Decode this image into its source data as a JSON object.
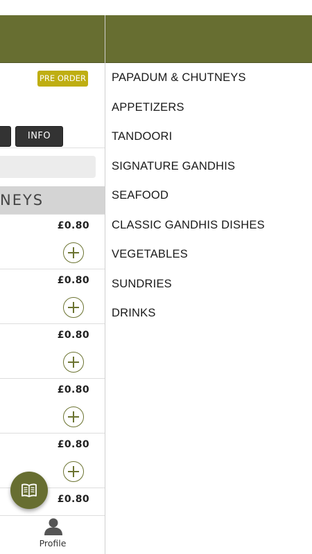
{
  "left_panel": {
    "preorder_label": "PRE ORDER",
    "info_button_label": "INFO",
    "category_banner": "NEYS",
    "items": [
      {
        "price": "£0.80"
      },
      {
        "price": "£0.80"
      },
      {
        "price": "£0.80"
      },
      {
        "price": "£0.80"
      },
      {
        "price": "£0.80"
      },
      {
        "price": "£0.80"
      }
    ],
    "bottom_nav": {
      "profile_label": "Profile"
    }
  },
  "drawer": {
    "categories": [
      {
        "label": "PAPADUM & CHUTNEYS"
      },
      {
        "label": "APPETIZERS"
      },
      {
        "label": "TANDOORI"
      },
      {
        "label": "SIGNATURE GANDHIS"
      },
      {
        "label": "SEAFOOD"
      },
      {
        "label": "CLASSIC GANDHIS DISHES"
      },
      {
        "label": "VEGETABLES"
      },
      {
        "label": "SUNDRIES"
      },
      {
        "label": "DRINKS"
      }
    ]
  },
  "colors": {
    "header_olive": "#676e31",
    "preorder_yellow": "#bfae12",
    "dark_button": "#333333",
    "banner_grey": "#d4d4d4"
  },
  "icons": {
    "add": "add-circle-icon",
    "menu_fab": "menu-book-icon",
    "profile": "person-icon"
  }
}
